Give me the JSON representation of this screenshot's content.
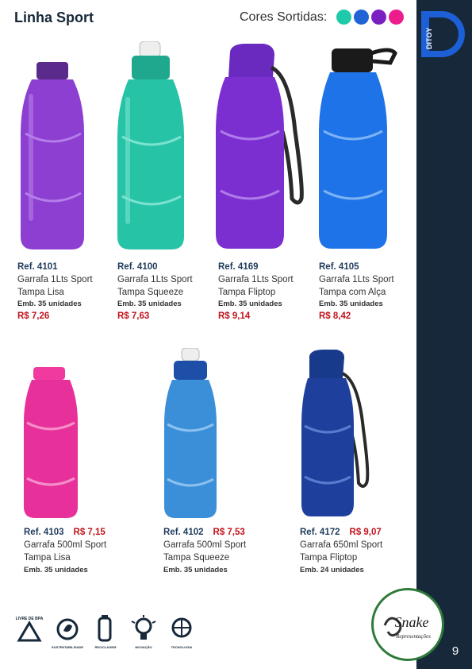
{
  "page": {
    "title": "Linha Sport",
    "colors_label": "Cores Sortidas:",
    "colors": [
      "#1fc9a9",
      "#1f63d4",
      "#7a1fc2",
      "#ec1c8c"
    ],
    "page_number": "9",
    "brand_logo_text": "DITOY"
  },
  "products": [
    {
      "ref": "Ref. 4101",
      "name1": "Garrafa 1Lts Sport",
      "name2": "Tampa Lisa",
      "emb": "Emb. 35 unidades",
      "price": "R$ 7,26",
      "color": "#8c3fd1"
    },
    {
      "ref": "Ref. 4100",
      "name1": "Garrafa 1Lts Sport",
      "name2": "Tampa Squeeze",
      "emb": "Emb. 35 unidades",
      "price": "R$ 7,63",
      "color": "#27c3a6"
    },
    {
      "ref": "Ref. 4169",
      "name1": "Garrafa 1Lts Sport",
      "name2": "Tampa Fliptop",
      "emb": "Emb. 35 unidades",
      "price": "R$ 9,14",
      "color": "#7b2fd0"
    },
    {
      "ref": "Ref. 4105",
      "name1": "Garrafa 1Lts Sport",
      "name2": "Tampa com Alça",
      "emb": "Emb. 35 unidades",
      "price": "R$ 8,42",
      "color": "#1f73e8"
    },
    {
      "ref": "Ref. 4103",
      "name1": "Garrafa 500ml Sport",
      "name2": "Tampa Lisa",
      "emb": "Emb. 35 unidades",
      "price": "R$ 7,15",
      "color": "#e8309a"
    },
    {
      "ref": "Ref. 4102",
      "name1": "Garrafa 500ml Sport",
      "name2": "Tampa Squeeze",
      "emb": "Emb. 35 unidades",
      "price": "R$ 7,53",
      "color": "#3b8fd8"
    },
    {
      "ref": "Ref. 4172",
      "name1": "Garrafa 650ml Sport",
      "name2": "Tampa Fliptop",
      "emb": "Emb. 24 unidades",
      "price": "R$ 9,07",
      "color": "#1f3f9c"
    }
  ],
  "icons": [
    {
      "name": "bpa-free-icon",
      "label": "LIVRE DE BPA"
    },
    {
      "name": "sustainability-icon",
      "label": "SUSTENTABILIDADE"
    },
    {
      "name": "recycling-icon",
      "label": "RECICLAGEM"
    },
    {
      "name": "innovation-icon",
      "label": "INOVAÇÃO"
    },
    {
      "name": "technology-icon",
      "label": "TECNOLOGIA"
    }
  ],
  "badge": {
    "line1": "Snake",
    "line2": "Representações"
  }
}
